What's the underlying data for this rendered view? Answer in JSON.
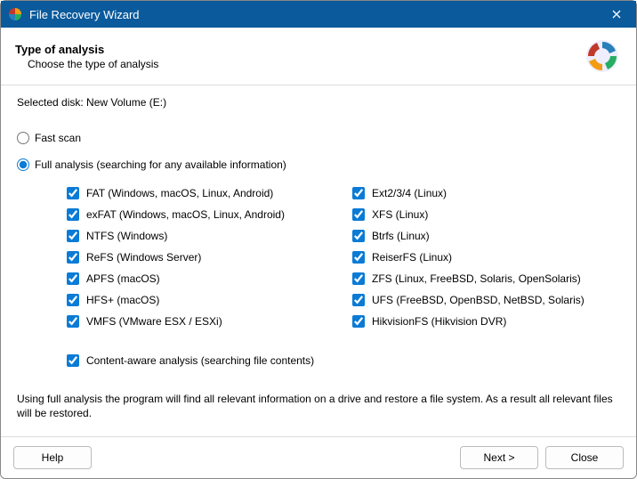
{
  "window": {
    "title": "File Recovery Wizard"
  },
  "header": {
    "title": "Type of analysis",
    "subtitle": "Choose the type of analysis"
  },
  "selected_disk": {
    "label": "Selected disk: ",
    "value": "New Volume (E:)"
  },
  "options": {
    "fast_scan": {
      "label": "Fast scan",
      "selected": false
    },
    "full_analysis": {
      "label": "Full analysis (searching for any available information)",
      "selected": true
    }
  },
  "filesystems": {
    "left": [
      {
        "label": "FAT (Windows, macOS, Linux, Android)",
        "checked": true
      },
      {
        "label": "exFAT (Windows, macOS, Linux, Android)",
        "checked": true
      },
      {
        "label": "NTFS (Windows)",
        "checked": true
      },
      {
        "label": "ReFS (Windows Server)",
        "checked": true
      },
      {
        "label": "APFS (macOS)",
        "checked": true
      },
      {
        "label": "HFS+ (macOS)",
        "checked": true
      },
      {
        "label": "VMFS (VMware ESX / ESXi)",
        "checked": true
      }
    ],
    "right": [
      {
        "label": "Ext2/3/4 (Linux)",
        "checked": true
      },
      {
        "label": "XFS (Linux)",
        "checked": true
      },
      {
        "label": "Btrfs (Linux)",
        "checked": true
      },
      {
        "label": "ReiserFS (Linux)",
        "checked": true
      },
      {
        "label": "ZFS (Linux, FreeBSD, Solaris, OpenSolaris)",
        "checked": true
      },
      {
        "label": "UFS (FreeBSD, OpenBSD, NetBSD, Solaris)",
        "checked": true
      },
      {
        "label": "HikvisionFS (Hikvision DVR)",
        "checked": true
      }
    ]
  },
  "content_aware": {
    "label": "Content-aware analysis (searching file contents)",
    "checked": true
  },
  "description": "Using full analysis the program will find all relevant information on a drive and restore a file system. As a result all relevant files will be restored.",
  "buttons": {
    "help": "Help",
    "next": "Next >",
    "close": "Close"
  }
}
